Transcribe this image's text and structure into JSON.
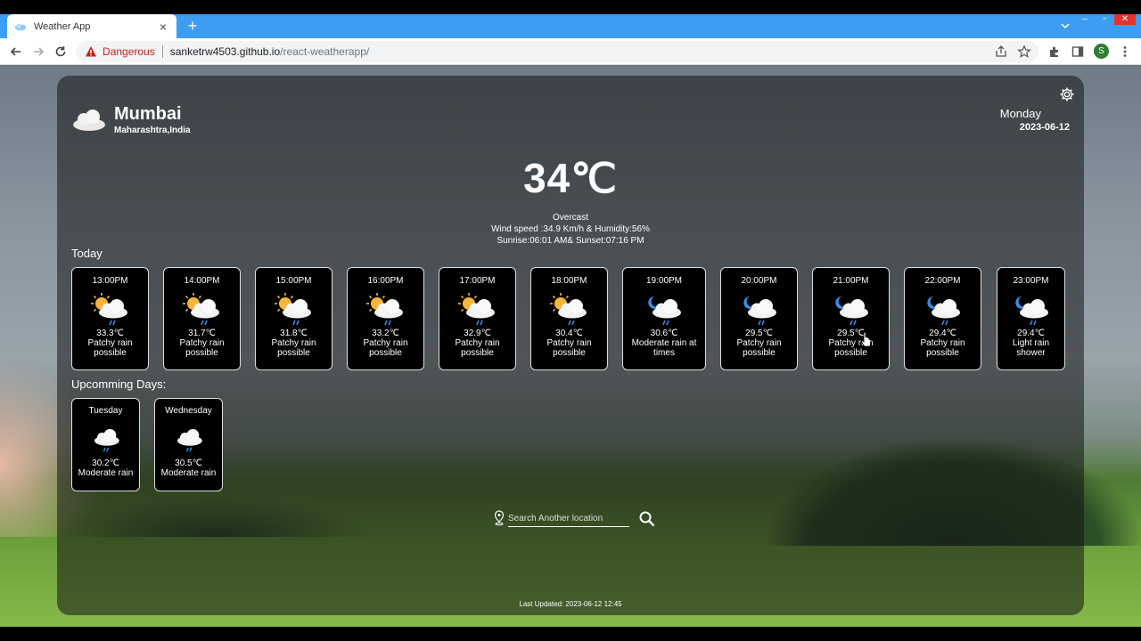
{
  "browser": {
    "tab_title": "Weather App",
    "new_tab": "+",
    "security_label": "Dangerous",
    "url_host": "sanketrw4503.github.io",
    "url_path": "/react-weatherapp/",
    "profile_initial": "S",
    "window_controls": [
      "–",
      "▫",
      "✕"
    ]
  },
  "location": {
    "city": "Mumbai",
    "region": "Maharashtra,India",
    "icon": "cloud-icon"
  },
  "date": {
    "day": "Monday",
    "date": "2023-06-12"
  },
  "current": {
    "temp": "34℃",
    "condition": "Overcast",
    "wind_humidity": "Wind speed :34.9 Km/h & Humidity:56%",
    "sun": "Sunrise:06:01 AM& Sunset:07:16 PM"
  },
  "labels": {
    "today": "Today",
    "upcoming": "Upcomming Days:",
    "search_placeholder": "Search Another location",
    "last_updated": "Last Updated: 2023-06-12 12:45"
  },
  "hourly": [
    {
      "time": "13:00PM",
      "temp": "33.3℃",
      "desc": "Patchy rain possible",
      "icon": "sun-cloud-rain-icon"
    },
    {
      "time": "14:00PM",
      "temp": "31.7℃",
      "desc": "Patchy rain possible",
      "icon": "sun-cloud-rain-icon"
    },
    {
      "time": "15:00PM",
      "temp": "31.8℃",
      "desc": "Patchy rain possible",
      "icon": "sun-cloud-rain-icon"
    },
    {
      "time": "16:00PM",
      "temp": "33.2℃",
      "desc": "Patchy rain possible",
      "icon": "sun-cloud-rain-icon"
    },
    {
      "time": "17:00PM",
      "temp": "32.9℃",
      "desc": "Patchy rain possible",
      "icon": "sun-cloud-rain-icon"
    },
    {
      "time": "18:00PM",
      "temp": "30.4℃",
      "desc": "Patchy rain possible",
      "icon": "sun-cloud-rain-icon"
    },
    {
      "time": "19:00PM",
      "temp": "30.6℃",
      "desc": "Moderate rain at times",
      "icon": "moon-cloud-rain-icon"
    },
    {
      "time": "20:00PM",
      "temp": "29.5℃",
      "desc": "Patchy rain possible",
      "icon": "moon-cloud-rain-icon"
    },
    {
      "time": "21:00PM",
      "temp": "29.5℃",
      "desc": "Patchy rain possible",
      "icon": "moon-cloud-rain-icon"
    },
    {
      "time": "22:00PM",
      "temp": "29.4℃",
      "desc": "Patchy rain possible",
      "icon": "moon-cloud-rain-icon"
    },
    {
      "time": "23:00PM",
      "temp": "29.4℃",
      "desc": "Light rain shower",
      "icon": "moon-cloud-rain-icon"
    }
  ],
  "upcoming": [
    {
      "day": "Tuesday",
      "temp": "30.2℃",
      "desc": "Moderate rain",
      "icon": "cloud-rain-icon"
    },
    {
      "day": "Wednesday",
      "temp": "30.5℃",
      "desc": "Moderate rain",
      "icon": "cloud-rain-icon"
    }
  ]
}
